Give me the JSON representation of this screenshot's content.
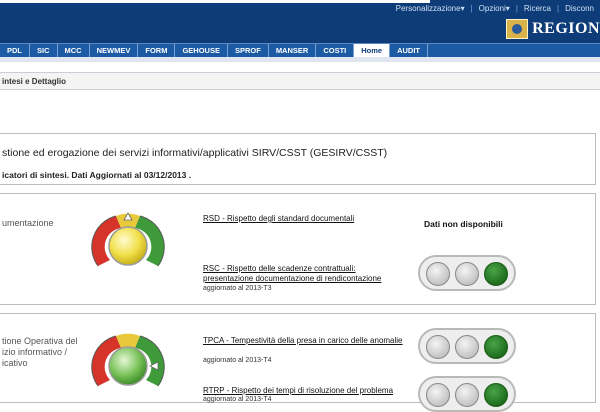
{
  "top_links": [
    "Personalizzazione▾",
    "Opzioni▾",
    "Ricerca",
    "Disconn"
  ],
  "region_label": "REGION",
  "nav_tabs": [
    {
      "label": "PDL",
      "active": false
    },
    {
      "label": "SIC",
      "active": false
    },
    {
      "label": "MCC",
      "active": false
    },
    {
      "label": "NEWMEV",
      "active": false
    },
    {
      "label": "FORM",
      "active": false
    },
    {
      "label": "GEHOUSE",
      "active": false
    },
    {
      "label": "SPROF",
      "active": false
    },
    {
      "label": "MANSER",
      "active": false
    },
    {
      "label": "COSTI",
      "active": false
    },
    {
      "label": "Home",
      "active": true
    },
    {
      "label": "AUDIT",
      "active": false
    }
  ],
  "breadcrumb": "intesi e Dettaglio",
  "info": {
    "title": "stione ed erogazione dei servizi informativi/applicativi SIRV/CSST (GESIRV/CSST)",
    "subtitle": "icatori di sintesi. Dati Aggiornati al 03/12/2013 ."
  },
  "panels": [
    {
      "area_label": [
        "umentazione"
      ],
      "gauge_color": "#f1e04a",
      "no_data": "Dati non disponibili",
      "indicators": [
        {
          "link": "RSD - Rispetto degli standard documentali",
          "updated": ""
        },
        {
          "link": "RSC - Rispetto delle scadenze contrattuali: presentazione documentazione di rendicontazione",
          "updated": "aggiornato al 2013-T3"
        }
      ],
      "semaforo": [
        "off",
        "off",
        "green"
      ]
    },
    {
      "area_label": [
        "tione Operativa del",
        "izio informativo /",
        "icativo"
      ],
      "gauge_color": "#7cc35a",
      "no_data": "",
      "indicators": [
        {
          "link": "TPCA - Tempestività della presa in carico delle anomalie",
          "updated": "aggiornato al 2013-T4"
        },
        {
          "link": "RTRP - Rispetto dei tempi di risoluzione del problema",
          "updated": "aggiornato al 2013-T4"
        }
      ],
      "semaforo": [
        "off",
        "off",
        "green"
      ]
    }
  ],
  "colors": {
    "header_bg": "#0d3c78",
    "nav_bg": "#1d5aa4",
    "signal_green": "#1b6a1a"
  }
}
